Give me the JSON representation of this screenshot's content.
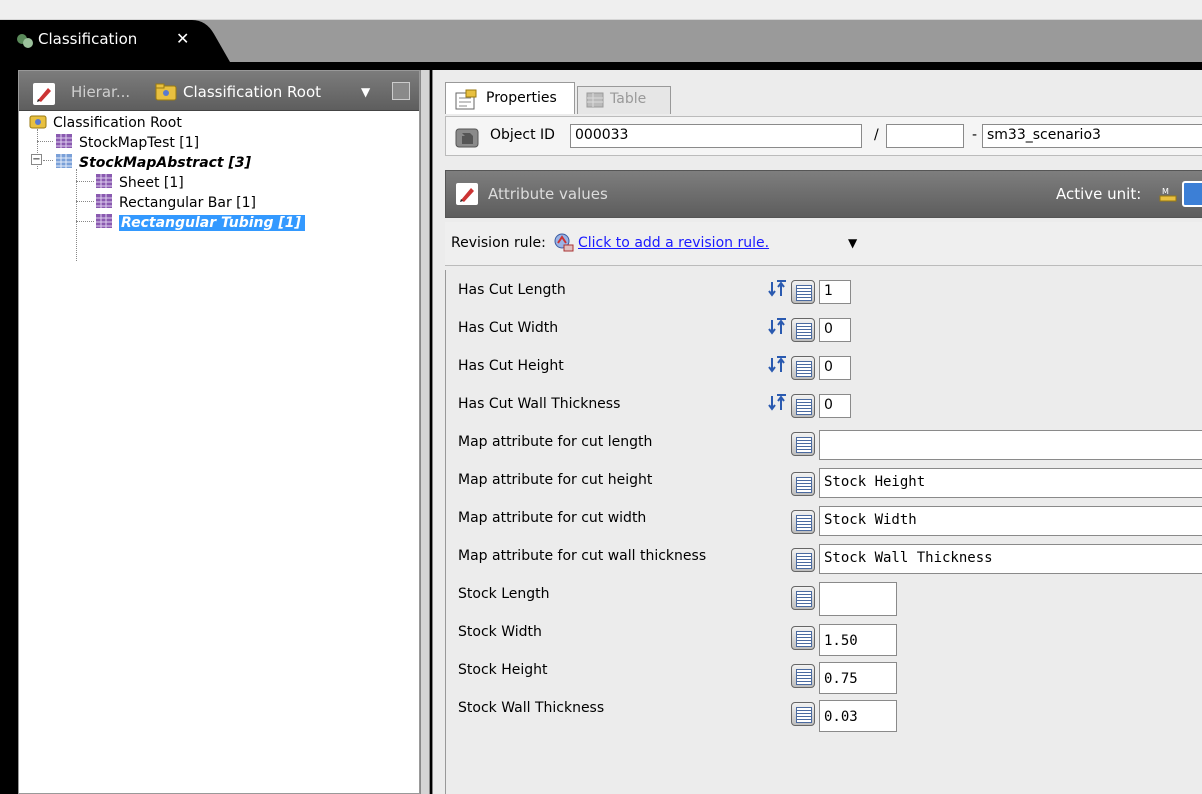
{
  "tab": {
    "title": "Classification",
    "close": "✕"
  },
  "left_toolbar": {
    "label1": "Hierar...",
    "label2": "Classification Root"
  },
  "tree": [
    {
      "label": "Classification Root"
    },
    {
      "label": "StockMapTest  [1]"
    },
    {
      "label": "StockMapAbstract  [3]"
    },
    {
      "label": "Sheet  [1]"
    },
    {
      "label": "Rectangular Bar  [1]"
    },
    {
      "label": "Rectangular Tubing  [1]"
    }
  ],
  "right_tabs": {
    "properties": "Properties",
    "table": "Table"
  },
  "object": {
    "label": "Object ID",
    "id": "000033",
    "slash": "/",
    "revision": "",
    "dash": "-",
    "name": "sm33_scenario3"
  },
  "attr_bar": {
    "label": "Attribute values",
    "active_unit": "Active unit:"
  },
  "revision": {
    "label": "Revision rule:",
    "link": "Click to add a revision rule."
  },
  "attributes": [
    {
      "label": "Has Cut Length",
      "value": "1"
    },
    {
      "label": "Has Cut Width",
      "value": "0"
    },
    {
      "label": "Has Cut Height",
      "value": "0"
    },
    {
      "label": "Has Cut Wall Thickness",
      "value": "0"
    },
    {
      "label": "Map attribute for cut length",
      "value": ""
    },
    {
      "label": "Map attribute for cut height",
      "value": "Stock Height"
    },
    {
      "label": "Map attribute for cut width",
      "value": "Stock Width"
    },
    {
      "label": "Map attribute for cut wall thickness",
      "value": "Stock Wall Thickness"
    },
    {
      "label": "Stock Length",
      "value": ""
    },
    {
      "label": "Stock Width",
      "value": "1.50"
    },
    {
      "label": "Stock Height",
      "value": "0.75"
    },
    {
      "label": "Stock Wall Thickness",
      "value": "0.03"
    }
  ],
  "colors": {
    "selection": "#3399ff",
    "link": "#1a1aff",
    "toolbar": "#6e6e6e"
  }
}
